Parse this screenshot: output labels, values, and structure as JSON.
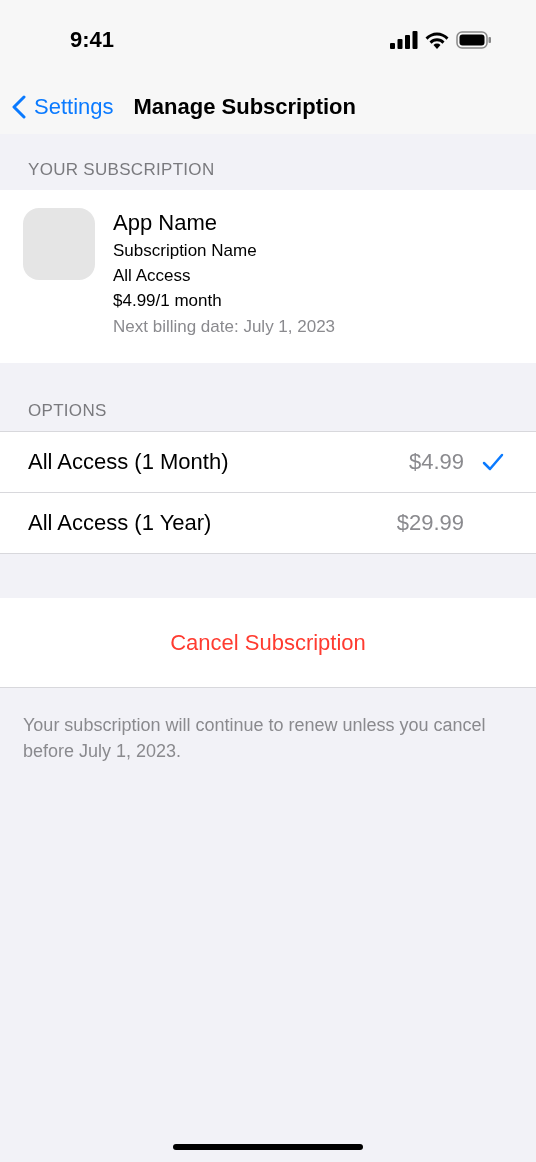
{
  "status_bar": {
    "time": "9:41"
  },
  "nav": {
    "back": "Settings",
    "title": "Manage Subscription"
  },
  "subscription": {
    "header": "YOUR SUBSCRIPTION",
    "app_name": "App Name",
    "subscription_name": "Subscription Name",
    "plan": "All Access",
    "price": "$4.99/1 month",
    "next_billing": "Next billing date: July 1, 2023"
  },
  "options": {
    "header": "OPTIONS",
    "items": [
      {
        "label": "All Access (1 Month)",
        "price": "$4.99",
        "selected": true
      },
      {
        "label": "All Access (1 Year)",
        "price": "$29.99",
        "selected": false
      }
    ]
  },
  "cancel_button": "Cancel Subscription",
  "footer": "Your subscription will continue to renew unless you cancel before July 1, 2023."
}
